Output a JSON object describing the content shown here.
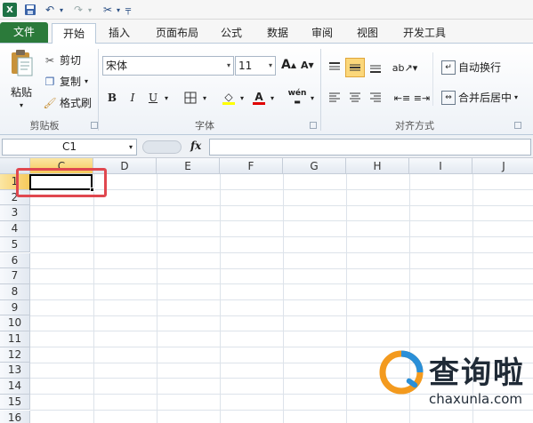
{
  "ribbon_tabs": [
    "文件",
    "开始",
    "插入",
    "页面布局",
    "公式",
    "数据",
    "审阅",
    "视图",
    "开发工具"
  ],
  "clipboard": {
    "paste_label": "粘贴",
    "cut_label": "剪切",
    "copy_label": "复制",
    "format_painter_label": "格式刷",
    "group_label": "剪贴板"
  },
  "font": {
    "font_name": "宋体",
    "font_size": "11",
    "bold": "B",
    "italic": "I",
    "underline": "U",
    "group_label": "字体",
    "grow": "A",
    "shrink": "A",
    "font_color_letter": "A",
    "phonetic": "wén"
  },
  "alignment": {
    "wrap_text_label": "自动换行",
    "merge_center_label": "合并后居中",
    "group_label": "对齐方式"
  },
  "formula_bar": {
    "name_box": "C1",
    "fx": "fx",
    "formula": ""
  },
  "columns": [
    "C",
    "D",
    "E",
    "F",
    "G",
    "H",
    "I",
    "J"
  ],
  "rows": [
    "1",
    "2",
    "3",
    "4",
    "5",
    "6",
    "7",
    "8",
    "9",
    "10",
    "11",
    "12",
    "13",
    "14",
    "15",
    "16"
  ],
  "selected_cell": "C1",
  "watermark": {
    "cn": "查询啦",
    "url": "chaxunla.com"
  },
  "colors": {
    "file_tab": "#2b7a3a",
    "selection_header": "#f6c95b",
    "highlight_box": "#e0474f",
    "watermark_orange": "#f39a1e",
    "watermark_blue": "#2a8fd8"
  }
}
